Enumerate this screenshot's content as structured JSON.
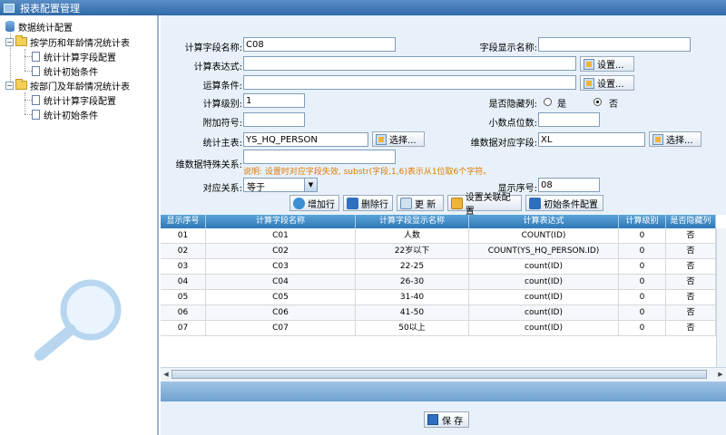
{
  "window": {
    "title": "报表配置管理"
  },
  "tree": {
    "root": "数据统计配置",
    "groups": [
      {
        "label": "按学历和年龄情况统计表",
        "items": [
          "统计计算字段配置",
          "统计初始条件"
        ]
      },
      {
        "label": "按部门及年龄情况统计表",
        "items": [
          "统计计算字段配置",
          "统计初始条件"
        ]
      }
    ]
  },
  "form": {
    "calc_field_name_label": "计算字段名称:",
    "calc_field_name_value": "C08",
    "field_display_name_label": "字段显示名称:",
    "field_display_name_value": "",
    "calc_expr_label": "计算表达式:",
    "calc_expr_value": "",
    "calc_condition_label": "运算条件:",
    "calc_condition_value": "",
    "set_label": "设置...",
    "calc_level_label": "计算级别:",
    "calc_level_value": "1",
    "hidden_col_label": "是否隐藏列:",
    "yes_label": "是",
    "no_label": "否",
    "hidden_col_selected": "否",
    "append_symbol_label": "附加符号:",
    "append_symbol_value": "",
    "decimal_places_label": "小数点位数:",
    "decimal_places_value": "",
    "main_table_label": "统计主表:",
    "main_table_value": "YS_HQ_PERSON",
    "choose_label": "选择...",
    "dimension_field_label": "维数据对应字段:",
    "dimension_field_value": "XL",
    "dimension_special_label": "维数据特殊关系:",
    "dimension_special_value": "",
    "hint": "说明: 设置时对应字段失效, substr(字段,1,6)表示从1位取6个字符。",
    "relation_label": "对应关系:",
    "relation_value": "等于",
    "display_order_label": "显示序号:",
    "display_order_value": "08"
  },
  "toolbar": {
    "add_row": "增加行",
    "delete_row": "删除行",
    "refresh": "更 新",
    "set_relation": "设置关联配置",
    "init_condition": "初始条件配置"
  },
  "grid": {
    "columns": [
      "显示序号",
      "计算字段名称",
      "计算字段显示名称",
      "计算表达式",
      "计算级别",
      "是否隐藏列"
    ],
    "rows": [
      [
        "01",
        "C01",
        "人数",
        "COUNT(ID)",
        "0",
        "否"
      ],
      [
        "02",
        "C02",
        "22岁以下",
        "COUNT(YS_HQ_PERSON.ID)",
        "0",
        "否"
      ],
      [
        "03",
        "C03",
        "22-25",
        "count(ID)",
        "0",
        "否"
      ],
      [
        "04",
        "C04",
        "26-30",
        "count(ID)",
        "0",
        "否"
      ],
      [
        "05",
        "C05",
        "31-40",
        "count(ID)",
        "0",
        "否"
      ],
      [
        "06",
        "C06",
        "41-50",
        "count(ID)",
        "0",
        "否"
      ],
      [
        "07",
        "C07",
        "50以上",
        "count(ID)",
        "0",
        "否"
      ]
    ]
  },
  "footer": {
    "save_label": "保 存"
  },
  "colors": {
    "accent": "#2f78b6",
    "panel_bg": "#e8f1fa",
    "hint": "#e07a00"
  }
}
